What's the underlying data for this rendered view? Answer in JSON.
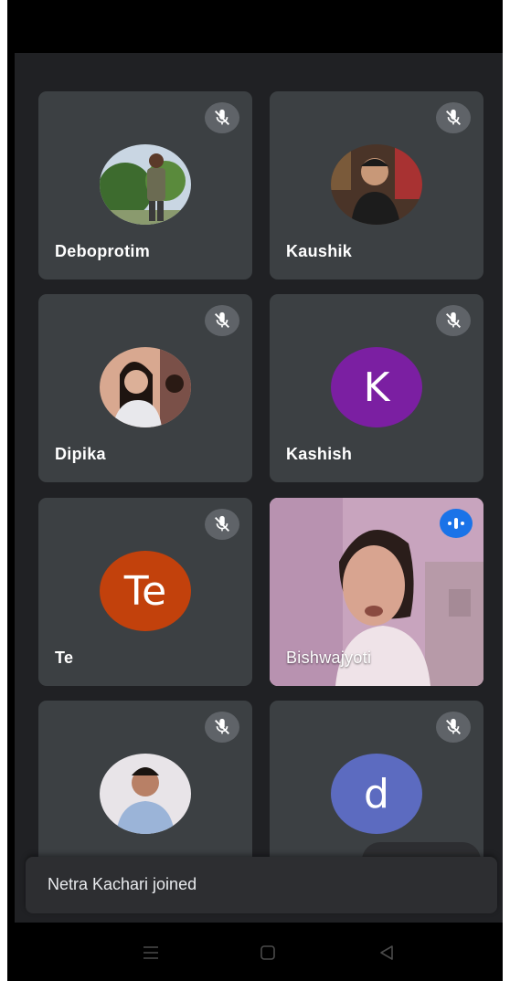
{
  "participants": [
    {
      "name": "Deboprotim",
      "muted": true,
      "avatar": "photo"
    },
    {
      "name": "Kaushik",
      "muted": true,
      "avatar": "photo"
    },
    {
      "name": "Dipika",
      "muted": true,
      "avatar": "photo"
    },
    {
      "name": "Kashish",
      "muted": true,
      "avatar": "letter",
      "initial": "K",
      "color": "#7b1fa2"
    },
    {
      "name": "Te",
      "muted": true,
      "avatar": "letter",
      "initial": "Te",
      "color": "#c2410c"
    },
    {
      "name": "Bishwajyoti",
      "muted": false,
      "speaking": true,
      "avatar": "video"
    },
    {
      "name": "",
      "muted": true,
      "avatar": "photo"
    },
    {
      "name": "",
      "muted": true,
      "avatar": "letter",
      "initial": "d",
      "color": "#5c6bc0"
    }
  ],
  "notification": {
    "text": "Netra Kachari joined"
  },
  "icons": {
    "muted": "mic-off-icon",
    "speaking": "audio-level-icon",
    "nav": [
      "menu-icon",
      "home-icon",
      "back-icon"
    ]
  },
  "colors": {
    "background": "#202124",
    "tile": "#3c4043",
    "mic_button": "#5f6368",
    "speaking_indicator": "#1a73e8"
  }
}
